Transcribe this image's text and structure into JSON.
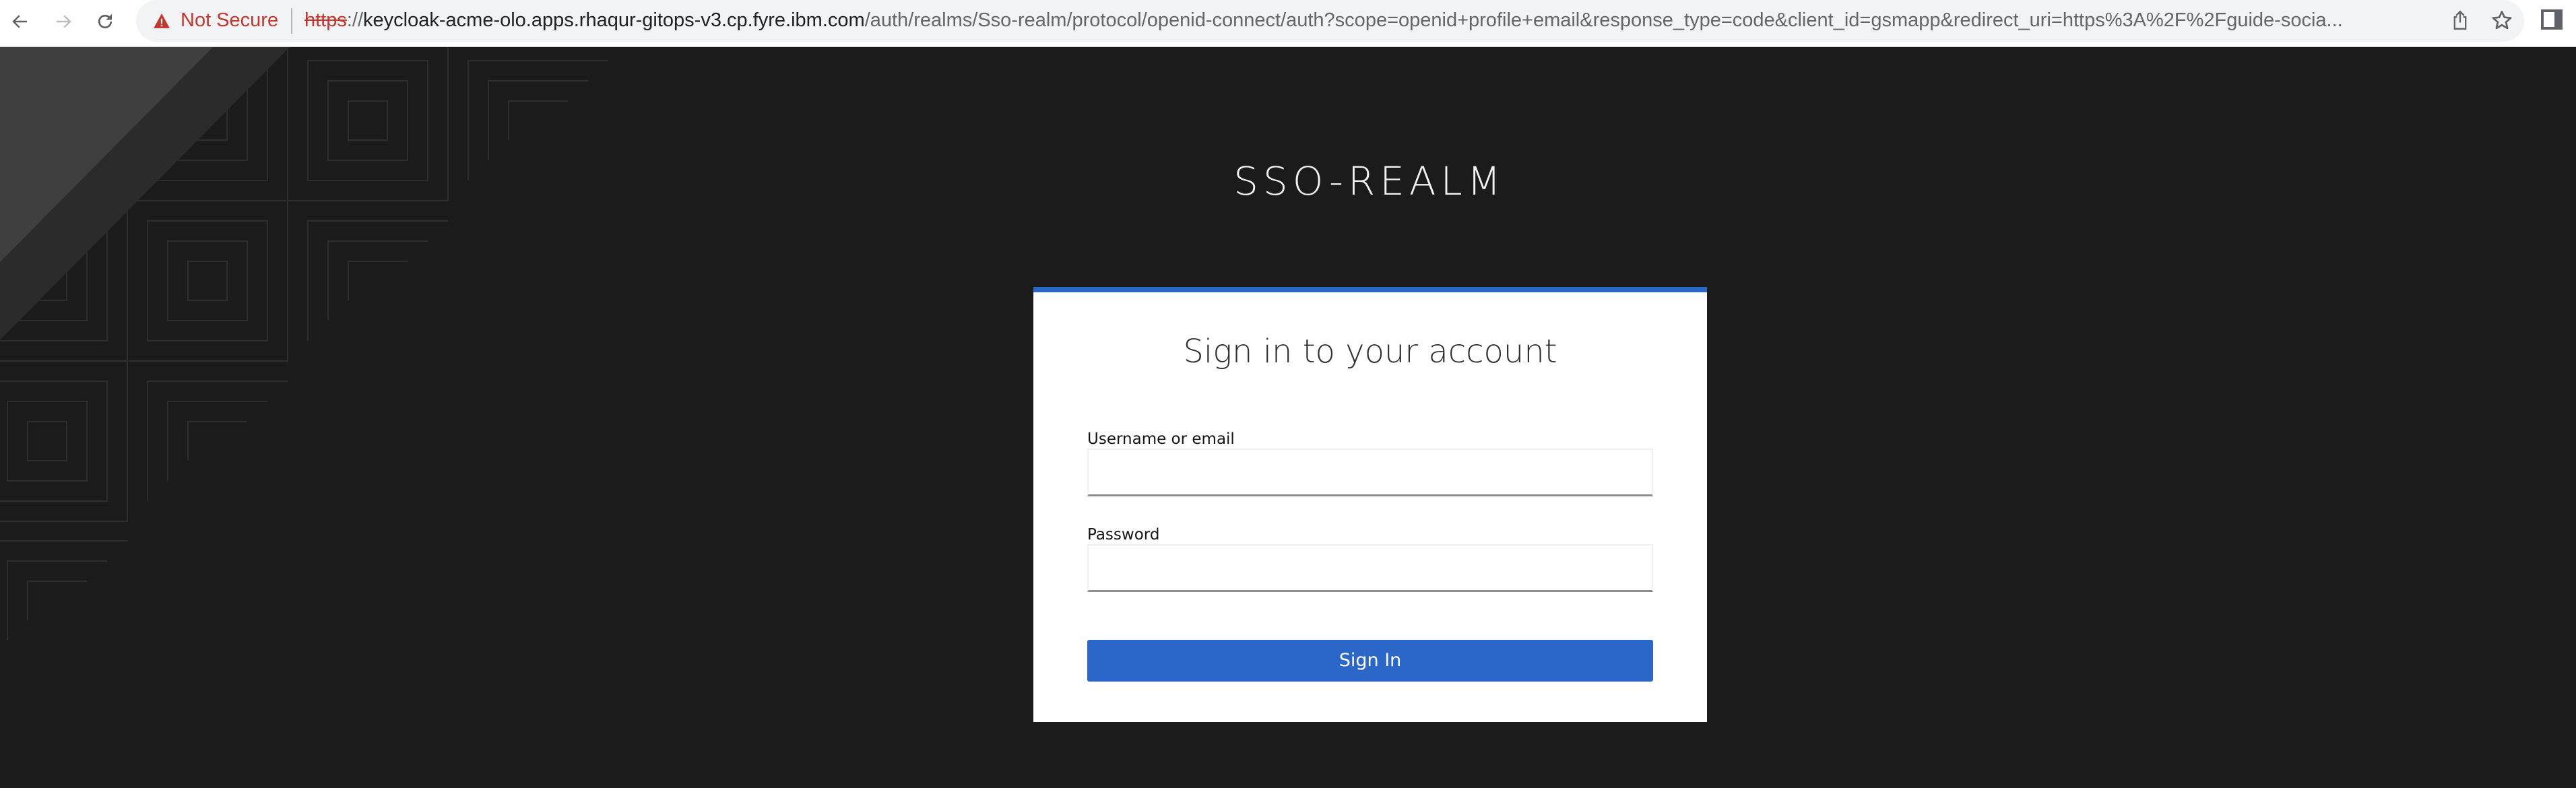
{
  "browser": {
    "security_label": "Not Secure",
    "url": {
      "scheme": "https",
      "separator": "://",
      "host": "keycloak-acme-olo.apps.rhaqur-gitops-v3.cp.fyre.ibm.com",
      "path_and_query": "/auth/realms/Sso-realm/protocol/openid-connect/auth?scope=openid+profile+email&response_type=code&client_id=gsmapp&redirect_uri=https%3A%2F%2Fguide-socia..."
    },
    "icons": {
      "back": "arrow-left-icon",
      "forward": "arrow-right-icon",
      "reload": "reload-icon",
      "warning": "warning-triangle-icon",
      "share": "share-icon",
      "bookmark": "star-icon",
      "sidebar": "sidebar-toggle-icon"
    },
    "colors": {
      "not_secure": "#c5372c",
      "omnibox_bg": "#f1f3f4"
    }
  },
  "page": {
    "realm_title": "SSO-REALM",
    "colors": {
      "background": "#1b1b1b",
      "card_accent": "#2b67c9",
      "primary_button": "#2b67c9"
    }
  },
  "login_card": {
    "heading": "Sign in to your account",
    "username": {
      "label": "Username or email",
      "value": "",
      "placeholder": ""
    },
    "password": {
      "label": "Password",
      "value": "",
      "placeholder": ""
    },
    "submit_label": "Sign In"
  }
}
